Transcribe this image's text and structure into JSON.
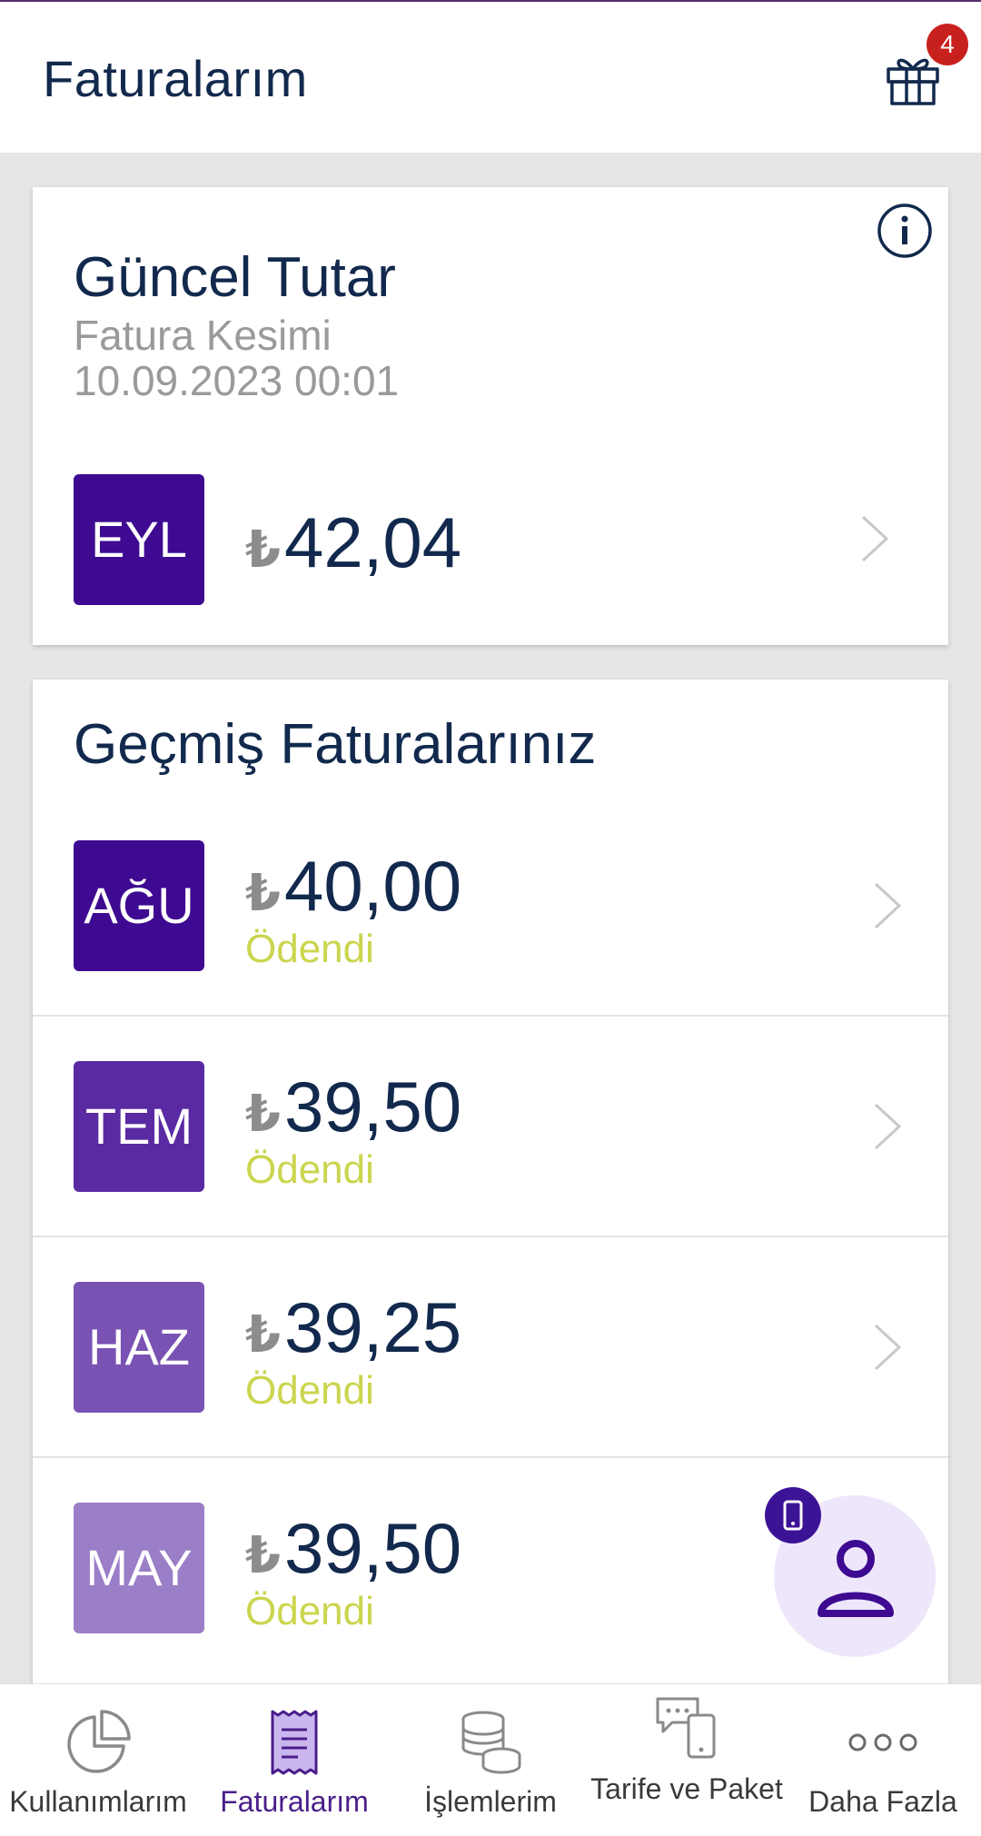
{
  "header": {
    "title": "Faturalarım",
    "gift_badge_count": "4"
  },
  "current_bill": {
    "title": "Güncel Tutar",
    "subtitle_line1": "Fatura Kesimi",
    "subtitle_line2": "10.09.2023 00:01",
    "month": "EYL",
    "currency_symbol": "₺",
    "amount": "42,04",
    "month_color": "#3d0a91"
  },
  "past_bills": {
    "title": "Geçmiş Faturalarınız",
    "items": [
      {
        "month": "AĞU",
        "currency_symbol": "₺",
        "amount": "40,00",
        "status": "Ödendi",
        "color": "#3d0a91"
      },
      {
        "month": "TEM",
        "currency_symbol": "₺",
        "amount": "39,50",
        "status": "Ödendi",
        "color": "#5a2aa3"
      },
      {
        "month": "HAZ",
        "currency_symbol": "₺",
        "amount": "39,25",
        "status": "Ödendi",
        "color": "#7a52b3"
      },
      {
        "month": "MAY",
        "currency_symbol": "₺",
        "amount": "39,50",
        "status": "Ödendi",
        "color": "#9a7ec7"
      }
    ]
  },
  "bottom_nav": {
    "items": [
      {
        "label": "Kullanımlarım",
        "icon": "pie-chart-icon",
        "active": false
      },
      {
        "label": "Faturalarım",
        "icon": "receipt-icon",
        "active": true
      },
      {
        "label": "İşlemlerim",
        "icon": "coins-icon",
        "active": false
      },
      {
        "label": "Tarife ve Paket",
        "icon": "phone-chat-icon",
        "active": false
      },
      {
        "label": "Daha Fazla",
        "icon": "more-dots-icon",
        "active": false
      }
    ]
  },
  "colors": {
    "brand": "#3d0a91",
    "text_dark": "#12294d",
    "paid_status": "#cbd54e",
    "badge_red": "#c8201d"
  }
}
